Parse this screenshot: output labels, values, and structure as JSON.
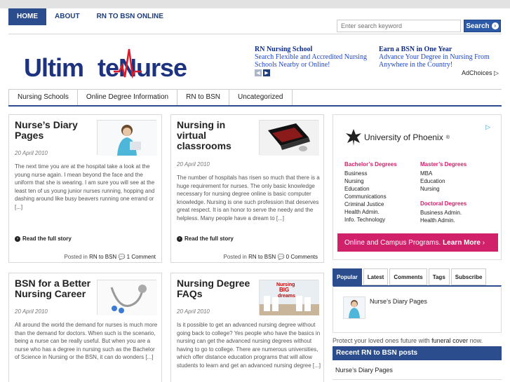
{
  "topnav": {
    "items": [
      {
        "label": "HOME"
      },
      {
        "label": "ABOUT"
      },
      {
        "label": "RN TO BSN ONLINE"
      }
    ]
  },
  "search": {
    "placeholder": "Enter search keyword",
    "button": "Search"
  },
  "logo": {
    "part1": "Ultim",
    "part2": "teNurse"
  },
  "ads": [
    {
      "title": "RN Nursing School",
      "desc": "Search Flexible and Accredited Nursing Schools Nearby or Online!"
    },
    {
      "title": "Earn a BSN in One Year",
      "desc": "Advance Your Degree in Nursing From Anywhere in the Country!"
    }
  ],
  "adchoices": "AdChoices",
  "catnav": {
    "items": [
      {
        "label": "Nursing Schools"
      },
      {
        "label": "Online Degree Information"
      },
      {
        "label": "RN to BSN"
      },
      {
        "label": "Uncategorized"
      }
    ]
  },
  "posts": [
    {
      "title": "Nurse’s Diary Pages",
      "date": "20 April 2010",
      "excerpt": "The next time you are at the hospital take a look at the young nurse again. I mean beyond the face and the uniform that she is wearing. I am sure you will see at the least ten of us young junior nurses running, hopping and dashing around like busy beavers running one errand or [...]",
      "more": "Read the full story",
      "meta_prefix": "Posted in",
      "category": "RN to BSN",
      "comments": "1 Comment"
    },
    {
      "title": "Nursing in virtual classrooms",
      "date": "20 April 2010",
      "excerpt": "The number of hospitals has risen so much that there is a huge requirement for nurses. The only basic knowledge necessary for nursing degree online is basic computer knowledge. Nursing is one such profession that deserves great respect.  It is an honor to serve the needy and the helpless. Many people have a dream to [...]",
      "more": "Read the full story",
      "meta_prefix": "Posted in",
      "category": "RN to BSN",
      "comments": "0 Comments"
    },
    {
      "title": "BSN for a Better Nursing Career",
      "date": "20 April 2010",
      "excerpt": "All around the world the demand for nurses is much more than the demand for doctors. When such is the scenario, being a nurse can be really useful. But when you are a nurse who has a degree in nursing such as the Bachelor of Science in Nursing or the BSN, it can do wonders [...]"
    },
    {
      "title": "Nursing Degree FAQs",
      "date": "20 April 2010",
      "excerpt": "Is it possible to get an advanced nursing degree without going back to college? Yes people who have the basics in nursing can get the advanced nursing degrees without having to go to college. There are numerous universities, which offer distance education programs that will allow students to learn and get an advanced nursing degree [...]",
      "thumb_text": [
        "Nursing",
        "BIG",
        "dreams"
      ]
    }
  ],
  "uop": {
    "brand": "University of Phoenix",
    "reg": "®",
    "bachelors_heading": "Bachelor’s Degrees",
    "bachelors": [
      "Business",
      "Nursing",
      "Education",
      "Communications",
      "Criminal Justice",
      "Health Admin.",
      "Info. Technology"
    ],
    "masters_heading": "Master’s Degrees",
    "masters": [
      "MBA",
      "Education",
      "Nursing"
    ],
    "doctoral_heading": "Doctoral Degrees",
    "doctoral": [
      "Business Admin.",
      "Health Admin."
    ],
    "bar_text": "Online and Campus Programs.",
    "bar_cta": "Learn More"
  },
  "tabs": [
    {
      "label": "Popular"
    },
    {
      "label": "Latest"
    },
    {
      "label": "Comments"
    },
    {
      "label": "Tags"
    },
    {
      "label": "Subscribe"
    }
  ],
  "popular": {
    "title": "Nurse’s Diary Pages"
  },
  "promo": {
    "text": "Protect your loved ones future with",
    "link": "funeral cover",
    "suffix": "now."
  },
  "recent": {
    "heading": "Recent RN to BSN posts",
    "items": [
      "Nurse’s Diary Pages"
    ]
  },
  "colors": {
    "nav": "#2c4d8d",
    "accent": "#d0216a",
    "logo": "#1e3380"
  }
}
